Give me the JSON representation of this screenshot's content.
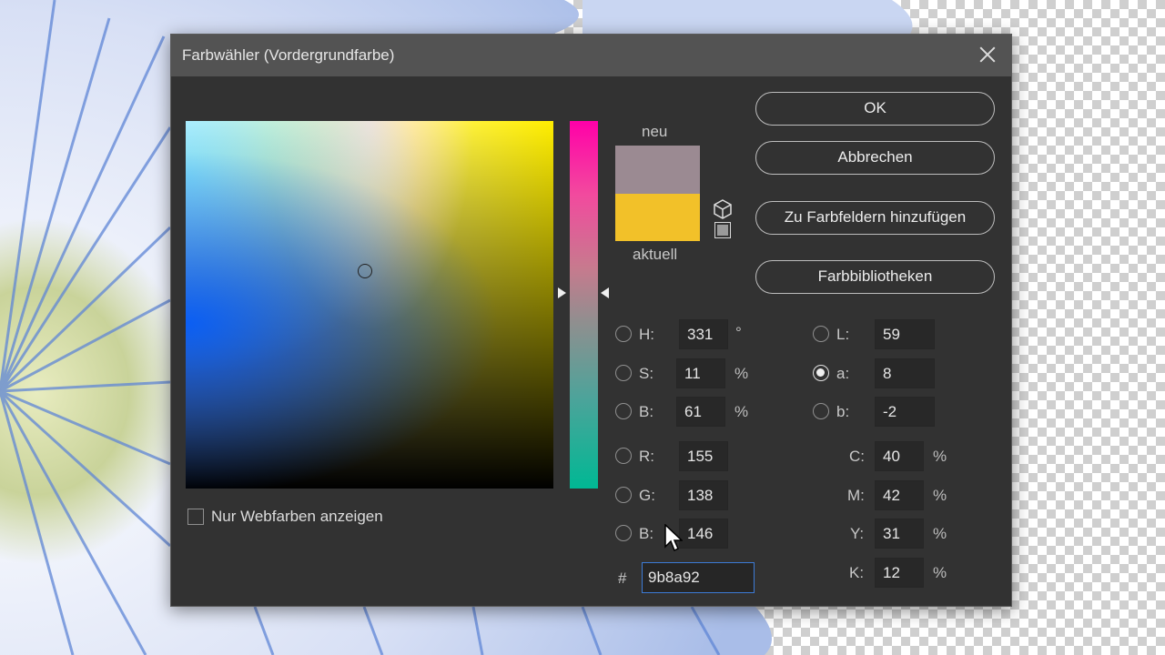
{
  "dialog": {
    "title": "Farbwähler (Vordergrundfarbe)"
  },
  "preview": {
    "new_label": "neu",
    "current_label": "aktuell",
    "new_color": "#9b8a92",
    "current_color": "#f2c129"
  },
  "buttons": {
    "ok": "OK",
    "cancel": "Abbrechen",
    "add_swatches": "Zu Farbfeldern hinzufügen",
    "libraries": "Farbbibliotheken"
  },
  "hsb": {
    "h_label": "H:",
    "h_value": "331",
    "h_unit": "°",
    "s_label": "S:",
    "s_value": "11",
    "s_unit": "%",
    "b_label": "B:",
    "b_value": "61",
    "b_unit": "%"
  },
  "rgb": {
    "r_label": "R:",
    "r_value": "155",
    "g_label": "G:",
    "g_value": "138",
    "b_label": "B:",
    "b_value": "146"
  },
  "lab": {
    "l_label": "L:",
    "l_value": "59",
    "a_label": "a:",
    "a_value": "8",
    "b_label": "b:",
    "b_value": "-2",
    "selected": "a"
  },
  "cmyk": {
    "c_label": "C:",
    "c_value": "40",
    "c_unit": "%",
    "m_label": "M:",
    "m_value": "42",
    "m_unit": "%",
    "y_label": "Y:",
    "y_value": "31",
    "y_unit": "%",
    "k_label": "K:",
    "k_value": "12",
    "k_unit": "%"
  },
  "hex": {
    "label": "#",
    "value": "9b8a92"
  },
  "web_only": {
    "label": "Nur Webfarben anzeigen",
    "checked": false
  },
  "colors": {
    "dialog_bg": "#323232",
    "titlebar_bg": "#535353",
    "hex_focus": "#3d7bd6"
  }
}
